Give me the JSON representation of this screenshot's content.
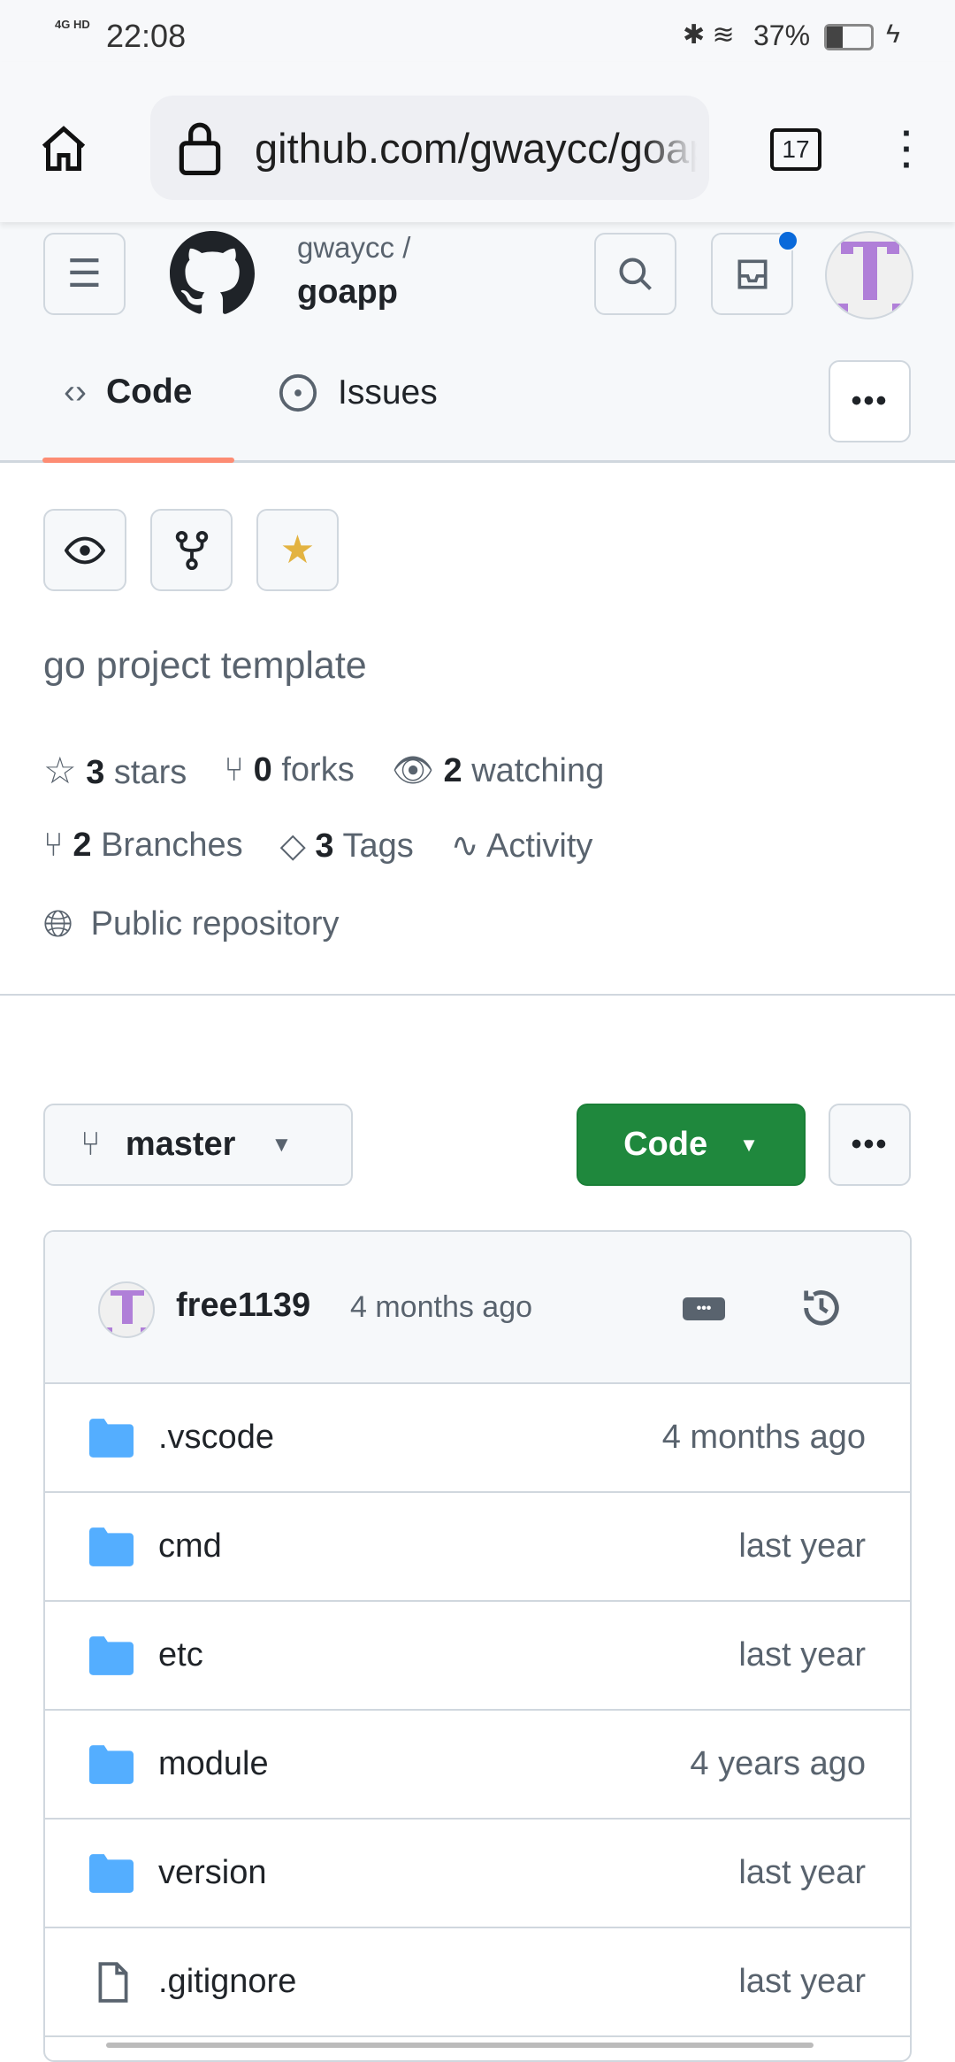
{
  "status_bar": {
    "network": "4G HD",
    "time": "22:08",
    "battery": "37%"
  },
  "browser": {
    "url": "github.com/gwaycc/goapp",
    "tab_count": "17"
  },
  "repo": {
    "owner": "gwaycc /",
    "name": "goapp",
    "description": "go project template"
  },
  "tabs": [
    {
      "label": "Code",
      "active": true
    },
    {
      "label": "Issues"
    }
  ],
  "stats": {
    "stars_count": "3",
    "stars_label": "stars",
    "forks_count": "0",
    "forks_label": "forks",
    "watching_count": "2",
    "watching_label": "watching",
    "branches_count": "2",
    "branches_label": "Branches",
    "tags_count": "3",
    "tags_label": "Tags",
    "activity_label": "Activity",
    "visibility": "Public repository"
  },
  "branch": {
    "name": "master"
  },
  "code_button": {
    "label": "Code",
    "color": "#1f883d"
  },
  "commit": {
    "author": "free1139",
    "time": "4 months ago"
  },
  "files": [
    {
      "name": ".vscode",
      "type": "folder",
      "time": "4 months ago"
    },
    {
      "name": "cmd",
      "type": "folder",
      "time": "last year"
    },
    {
      "name": "etc",
      "type": "folder",
      "time": "last year"
    },
    {
      "name": "module",
      "type": "folder",
      "time": "4 years ago"
    },
    {
      "name": "version",
      "type": "folder",
      "time": "last year"
    },
    {
      "name": ".gitignore",
      "type": "file",
      "time": "last year"
    }
  ],
  "colors": {
    "folder": "#54aeff",
    "tab_underline": "#fd8c73",
    "notification": "#0969da",
    "avatar": "#b07fd8"
  }
}
